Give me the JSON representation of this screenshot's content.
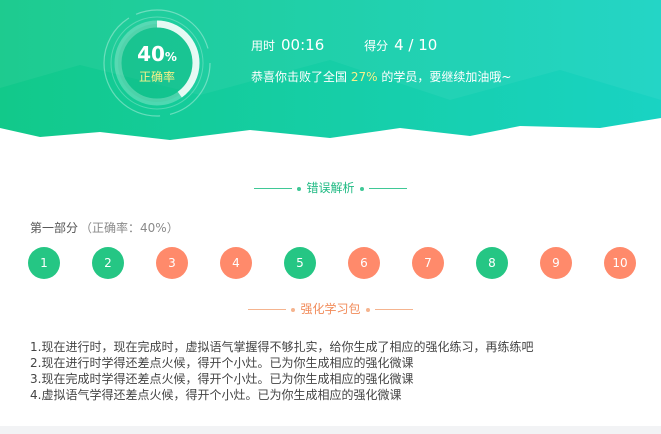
{
  "colors": {
    "banner_gradient_left": "#12c98a",
    "banner_gradient_right": "#19d3c3",
    "correct": "#25c684",
    "wrong": "#ff8a6b",
    "highlight": "#f6f08a",
    "error_title": "#1fba83",
    "pack_title": "#f18b5a"
  },
  "summary": {
    "accuracy_value": "40",
    "accuracy_symbol": "%",
    "accuracy_fraction": 0.4,
    "accuracy_label": "正确率",
    "time_label": "用时",
    "time_value": "00:16",
    "score_label": "得分",
    "score_value": "4 / 10",
    "message_prefix": "恭喜你击败了全国",
    "message_percent": "27%",
    "message_suffix": "的学员，要继续加油哦~"
  },
  "errors": {
    "title": "错误解析",
    "part_label": "第一部分",
    "part_accuracy": "（正确率：40%）",
    "questions": [
      {
        "label": "1",
        "status": "correct"
      },
      {
        "label": "2",
        "status": "correct"
      },
      {
        "label": "3",
        "status": "wrong"
      },
      {
        "label": "4",
        "status": "wrong"
      },
      {
        "label": "5",
        "status": "correct"
      },
      {
        "label": "6",
        "status": "wrong"
      },
      {
        "label": "7",
        "status": "wrong"
      },
      {
        "label": "8",
        "status": "correct"
      },
      {
        "label": "9",
        "status": "wrong"
      },
      {
        "label": "10",
        "status": "wrong"
      }
    ]
  },
  "pack": {
    "title": "强化学习包",
    "items": [
      "1.现在进行时，现在完成时，虚拟语气掌握得不够扎实，给你生成了相应的强化练习，再练练吧",
      "2.现在进行时学得还差点火候，得开个小灶。已为你生成相应的强化微课",
      "3.现在完成时学得还差点火候，得开个小灶。已为你生成相应的强化微课",
      "4.虚拟语气学得还差点火候，得开个小灶。已为你生成相应的强化微课"
    ]
  }
}
